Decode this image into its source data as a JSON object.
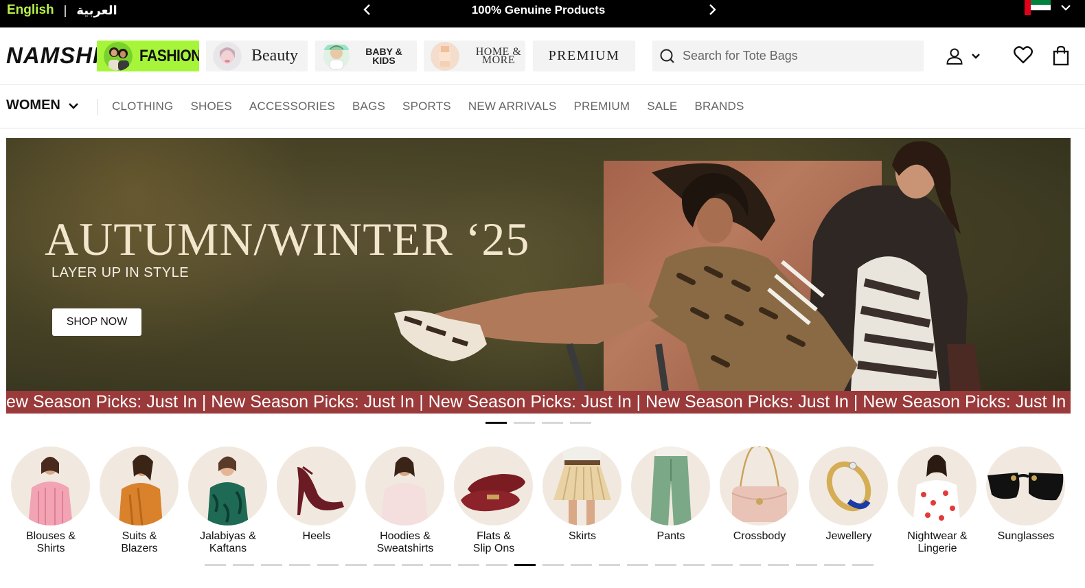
{
  "topbar": {
    "lang_en": "English",
    "lang_separator": "|",
    "lang_ar": "العربية",
    "promo": "100% Genuine Products",
    "prev_icon": "chevron-left-icon",
    "next_icon": "chevron-right-icon",
    "flag": "uae-flag",
    "flag_colors": [
      "#e0001b",
      "#00843d",
      "#ffffff",
      "#000000"
    ]
  },
  "header": {
    "logo": "NAMSHI",
    "tiles": [
      {
        "label": "FASHION",
        "bg": "#a6f53a"
      },
      {
        "label": "Beauty"
      },
      {
        "label": "BABY & KIDS"
      },
      {
        "label": "HOME & MORE"
      },
      {
        "label": "PREMIUM"
      }
    ],
    "search_placeholder": "Search for Tote Bags",
    "icons": [
      "user-icon",
      "chevron-down-icon",
      "heart-icon",
      "bag-icon"
    ]
  },
  "nav": {
    "gender": "WOMEN",
    "links": [
      "CLOTHING",
      "SHOES",
      "ACCESSORIES",
      "BAGS",
      "SPORTS",
      "NEW ARRIVALS",
      "PREMIUM",
      "SALE",
      "BRANDS"
    ]
  },
  "hero": {
    "title": "AUTUMN/WINTER ‘25",
    "subtitle": "LAYER UP IN STYLE",
    "cta": "SHOP NOW",
    "ticker": "ew Season Picks: Just In | New Season Picks: Just In | New Season Picks: Just In | New Season Picks: Just In | New Season Picks: Just In",
    "ticker_color": "#9a3a3a",
    "slides": 4,
    "active_slide": 1
  },
  "categories": {
    "items": [
      {
        "line1": "Blouses &",
        "line2": "Shirts"
      },
      {
        "line1": "Suits &",
        "line2": "Blazers"
      },
      {
        "line1": "Jalabiyas &",
        "line2": "Kaftans"
      },
      {
        "line1": "Heels",
        "line2": ""
      },
      {
        "line1": "Hoodies &",
        "line2": "Sweatshirts"
      },
      {
        "line1": "Flats &",
        "line2": "Slip Ons"
      },
      {
        "line1": "Skirts",
        "line2": ""
      },
      {
        "line1": "Pants",
        "line2": ""
      },
      {
        "line1": "Crossbody",
        "line2": ""
      },
      {
        "line1": "Jewellery",
        "line2": ""
      },
      {
        "line1": "Nightwear &",
        "line2": "Lingerie"
      },
      {
        "line1": "Sunglasses",
        "line2": ""
      }
    ],
    "pages": 24,
    "active_page": 12
  }
}
